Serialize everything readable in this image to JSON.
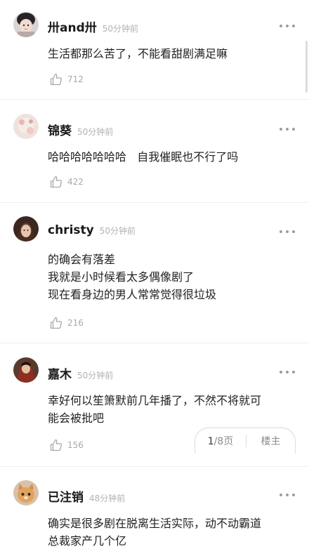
{
  "comments": [
    {
      "username": "卅and卅",
      "time": "50分钟前",
      "lines": [
        "生活都那么苦了，不能看甜剧满足嘛"
      ],
      "likes": "712"
    },
    {
      "username": "锦葵",
      "time": "50分钟前",
      "lines": [
        "哈哈哈哈哈哈哈   自我催眠也不行了吗"
      ],
      "likes": "422"
    },
    {
      "username": "christy",
      "time": "50分钟前",
      "lines": [
        "的确会有落差",
        "我就是小时候看太多偶像剧了",
        "现在看身边的男人常常觉得很垃圾"
      ],
      "likes": "216"
    },
    {
      "username": "嘉木",
      "time": "50分钟前",
      "lines": [
        "幸好何以笙箫默前几年播了，不然不将就可",
        "能会被批吧"
      ],
      "likes": "156"
    },
    {
      "username": "已注销",
      "time": "48分钟前",
      "lines": [
        "确实是很多剧在脱离生活实际，动不动霸道",
        "总裁家产几个亿"
      ],
      "likes": ""
    }
  ],
  "pager": {
    "current": "1",
    "total": "/8页",
    "floor_label": "楼主"
  },
  "colors": {
    "username": "#1a1a1a",
    "time": "#b2b2b2",
    "text": "#222222",
    "likes": "#a8a8a8",
    "divider": "#efefef"
  }
}
